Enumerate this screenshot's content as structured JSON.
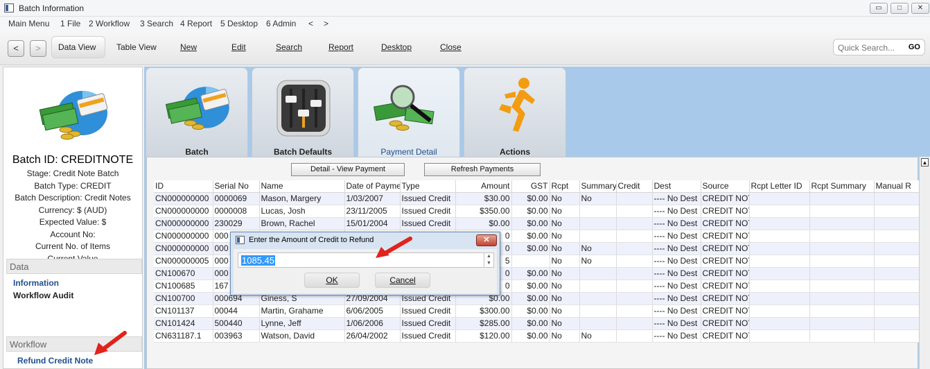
{
  "window": {
    "title": "Batch Information",
    "minimize": "▭",
    "maximize": "□",
    "close": "✕"
  },
  "menu": [
    "Main Menu",
    "1 File",
    "2 Workflow",
    "3 Search",
    "4 Report",
    "5 Desktop",
    "6 Admin",
    "<",
    ">"
  ],
  "toolbar": {
    "back": "<",
    "forward": ">",
    "data_view": "Data View",
    "table_view": "Table View",
    "new": "New",
    "edit": "Edit",
    "search": "Search",
    "report": "Report",
    "desktop": "Desktop",
    "close": "Close",
    "quick_search_placeholder": "Quick Search...",
    "go": "GO"
  },
  "left": {
    "batch_id": "Batch ID: CREDITNOTE",
    "lines": [
      "Stage: Credit Note Batch",
      "Batch Type: CREDIT",
      "Batch Description: Credit Notes",
      "Currency: $ (AUD)",
      "Expected Value: $",
      "Account No:",
      "Current No. of Items",
      "Current Value"
    ],
    "data_header": "Data",
    "data_links": [
      "Information",
      "Workflow Audit"
    ],
    "workflow_header": "Workflow",
    "workflow_link": "Refund Credit Note"
  },
  "tiles": [
    "Batch",
    "Batch Defaults",
    "Payment Detail",
    "Actions"
  ],
  "buttons": {
    "detail_view": "Detail - View Payment",
    "refresh": "Refresh Payments"
  },
  "table": {
    "columns": [
      "ID",
      "Serial No",
      "Name",
      "Date of Payment",
      "Type",
      "Amount",
      "GST",
      "Rcpt",
      "Summary",
      "Credit",
      "Dest",
      "Source",
      "Rcpt Letter ID",
      "Rcpt Summary",
      "Manual R"
    ],
    "rows": [
      [
        "CN000000000",
        "0000069",
        "Mason, Margery",
        "1/03/2007",
        "Issued Credit",
        "$30.00",
        "$0.00",
        "No",
        "No",
        "",
        "---- No Dest",
        "CREDIT NOTE",
        "",
        "",
        ""
      ],
      [
        "CN000000000",
        "0000008",
        "Lucas, Josh",
        "23/11/2005",
        "Issued Credit",
        "$350.00",
        "$0.00",
        "No",
        "",
        "",
        "---- No Dest",
        "CREDIT NOTE",
        "",
        "",
        ""
      ],
      [
        "CN000000000",
        "230029",
        "Brown, Rachel",
        "15/01/2004",
        "Issued Credit",
        "$0.00",
        "$0.00",
        "No",
        "",
        "",
        "---- No Dest",
        "CREDIT NOTE",
        "",
        "",
        ""
      ],
      [
        "CN000000000",
        "000",
        "",
        "",
        "",
        "0",
        "$0.00",
        "No",
        "",
        "",
        "---- No Dest",
        "CREDIT NOTE",
        "",
        "",
        ""
      ],
      [
        "CN000000000",
        "000",
        "",
        "",
        "",
        "0",
        "$0.00",
        "No",
        "No",
        "",
        "---- No Dest",
        "CREDIT NOTE",
        "",
        "",
        ""
      ],
      [
        "CN000000005",
        "000",
        "",
        "",
        "",
        "5",
        "",
        "No",
        "No",
        "",
        "---- No Dest",
        "CREDIT NOTE",
        "",
        "",
        ""
      ],
      [
        "CN100670",
        "000",
        "",
        "",
        "",
        "0",
        "$0.00",
        "No",
        "",
        "",
        "---- No Dest",
        "CREDIT NOTE",
        "",
        "",
        ""
      ],
      [
        "CN100685",
        "167",
        "",
        "",
        "",
        "0",
        "$0.00",
        "No",
        "",
        "",
        "---- No Dest",
        "CREDIT NOTE",
        "",
        "",
        ""
      ],
      [
        "CN100700",
        "000694",
        "Giness, S",
        "27/09/2004",
        "Issued Credit",
        "$0.00",
        "$0.00",
        "No",
        "",
        "",
        "---- No Dest",
        "CREDIT NOTE",
        "",
        "",
        ""
      ],
      [
        "CN101137",
        "00044",
        "Martin, Grahame",
        "6/06/2005",
        "Issued Credit",
        "$300.00",
        "$0.00",
        "No",
        "",
        "",
        "---- No Dest",
        "CREDIT NOTE",
        "",
        "",
        ""
      ],
      [
        "CN101424",
        "500440",
        "Lynne, Jeff",
        "1/06/2006",
        "Issued Credit",
        "$285.00",
        "$0.00",
        "No",
        "",
        "",
        "---- No Dest",
        "CREDIT NOTE",
        "",
        "",
        ""
      ],
      [
        "CN631187.1",
        "003963",
        "Watson, David",
        "26/04/2002",
        "Issued Credit",
        "$120.00",
        "$0.00",
        "No",
        "No",
        "",
        "---- No Dest",
        "CREDIT NOTE",
        "",
        "",
        ""
      ]
    ]
  },
  "dialog": {
    "title": "Enter the Amount of Credit to Refund",
    "close": "✕",
    "value": "1085.45",
    "ok": "OK",
    "cancel": "Cancel"
  },
  "colors": {
    "accent_blue": "#1f4e8c",
    "main_bg": "#a8c9ea",
    "alt_row": "#eef0fb",
    "arrow_red": "#e0241b"
  }
}
